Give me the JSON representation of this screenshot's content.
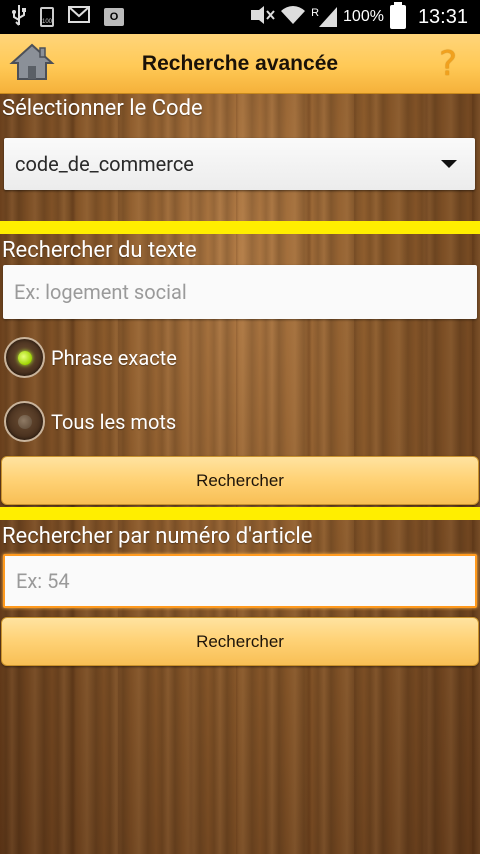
{
  "status_bar": {
    "left_icons": [
      "usb-icon",
      "battery-small-icon",
      "gmail-icon",
      "outlook-icon"
    ],
    "right_icons": [
      "nfc-mute-icon",
      "wifi-icon",
      "signal-icon",
      "battery-icon"
    ],
    "battery_small_text": "100",
    "roaming": "R",
    "battery_percent": "100%",
    "time": "13:31"
  },
  "header": {
    "title": "Recherche avancée",
    "home_icon": "home-icon",
    "help_label": "?"
  },
  "code_section": {
    "label": "Sélectionner le Code",
    "selected_value": "code_de_commerce"
  },
  "text_section": {
    "label": "Rechercher du texte",
    "placeholder": "Ex: logement social",
    "options": [
      {
        "label": "Phrase exacte",
        "selected": true
      },
      {
        "label": "Tous les mots",
        "selected": false
      }
    ],
    "button_label": "Rechercher"
  },
  "article_section": {
    "label": "Rechercher par numéro d'article",
    "placeholder": "Ex: 54",
    "button_label": "Rechercher"
  },
  "colors": {
    "header_accent": "#ffc956",
    "separator_yellow": "#ffee00",
    "radio_selected": "#9ed400",
    "focus_border": "#ff9a1e"
  }
}
